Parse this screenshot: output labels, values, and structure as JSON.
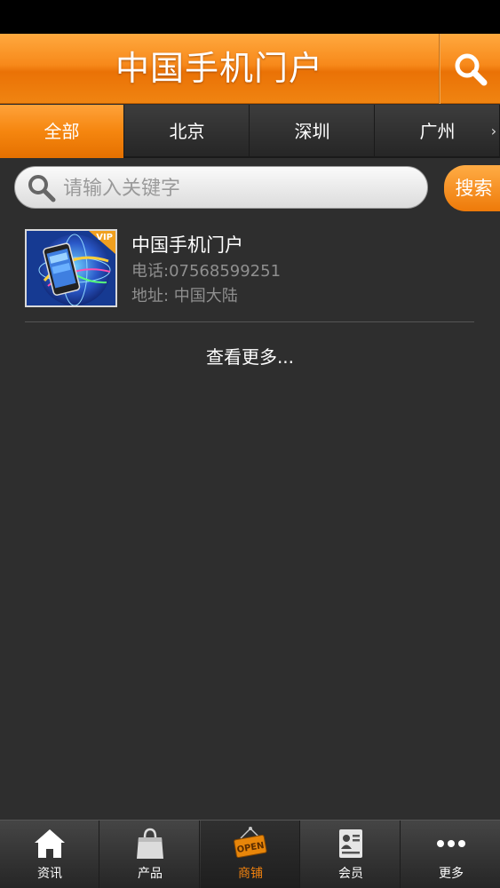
{
  "header": {
    "title": "中国手机门户"
  },
  "tabs": {
    "left_arrow": "‹",
    "right_arrow": "›",
    "items": [
      {
        "label": "全部"
      },
      {
        "label": "北京"
      },
      {
        "label": "深圳"
      },
      {
        "label": "广州"
      }
    ]
  },
  "search": {
    "placeholder": "请输入关键字",
    "value": "",
    "button_label": "搜索"
  },
  "listing": {
    "badge": "VIP",
    "name": "中国手机门户",
    "phone": "电话:07568599251",
    "address": "地址: 中国大陆"
  },
  "view_more": "查看更多...",
  "bottom_nav": [
    {
      "label": "资讯",
      "icon": "home-icon"
    },
    {
      "label": "产品",
      "icon": "shopping-bag-icon"
    },
    {
      "label": "商铺",
      "icon": "open-sign-icon",
      "sign_text": "OPEN"
    },
    {
      "label": "会员",
      "icon": "member-card-icon"
    },
    {
      "label": "更多",
      "icon": "more-dots-icon"
    }
  ],
  "colors": {
    "accent": "#f08411",
    "background": "#2e2e2e",
    "active_nav": "#f2820e"
  }
}
